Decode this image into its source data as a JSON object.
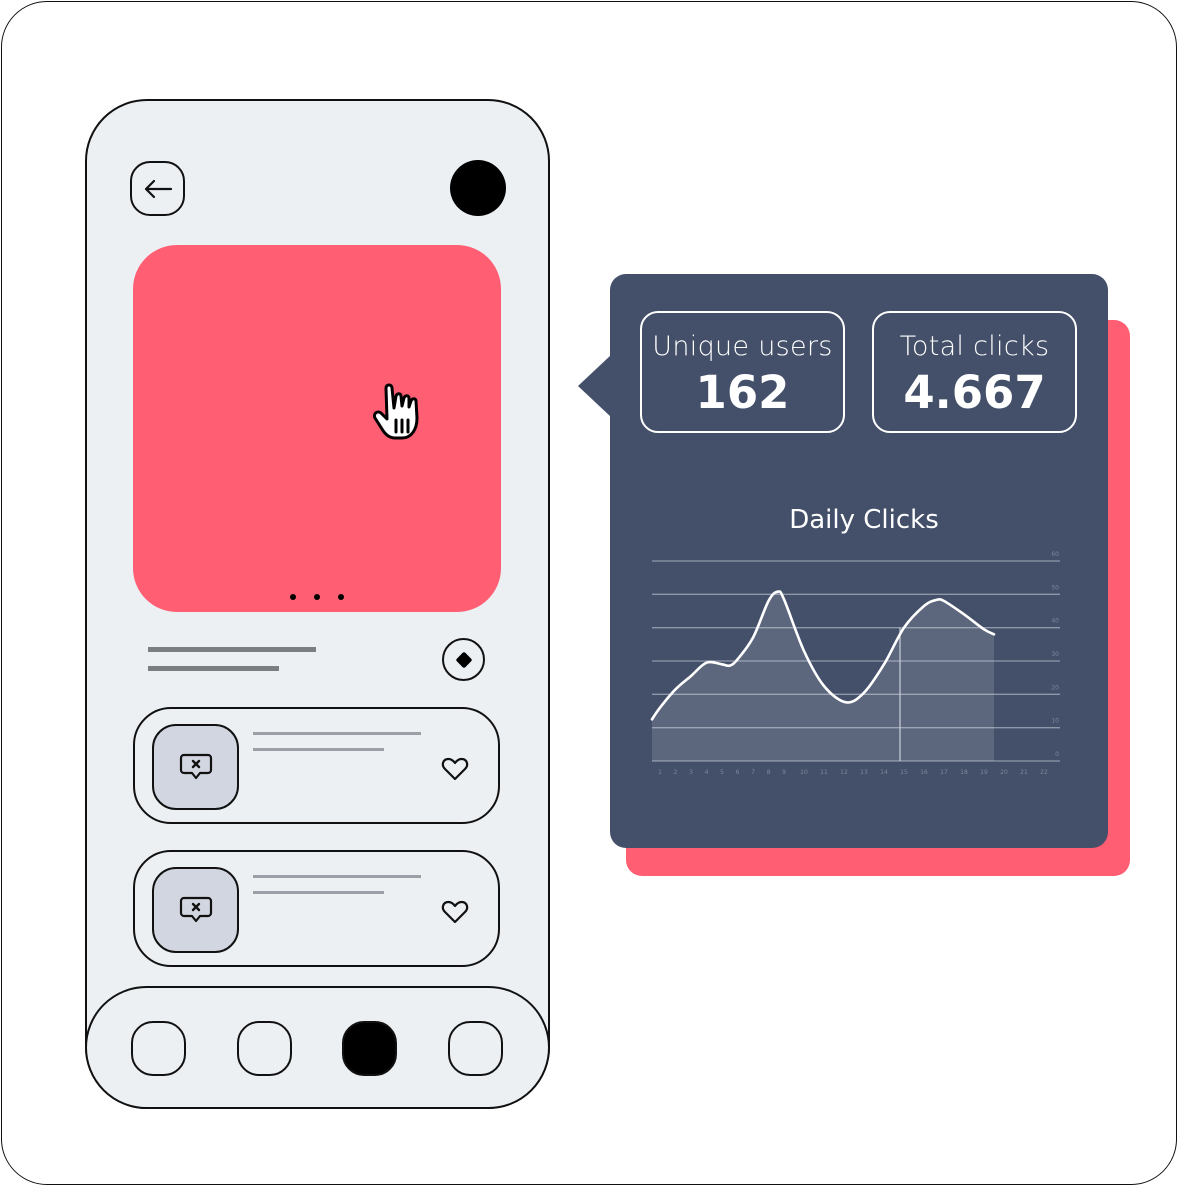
{
  "phone": {
    "back_icon": "arrow-left-icon",
    "avatar_icon": "avatar-circle",
    "hero": {
      "carousel_dots": 3,
      "color": "#ff5e73",
      "cursor_icon": "hand-pointer-icon"
    },
    "action_icon": "diamond-icon",
    "cards": [
      {
        "thumb_icon": "message-x-icon",
        "like_icon": "heart-icon"
      },
      {
        "thumb_icon": "message-x-icon",
        "like_icon": "heart-icon"
      }
    ],
    "tabbar": {
      "tabs": 4,
      "active_index": 2
    }
  },
  "analytics": {
    "accent": "#ff5e73",
    "panel_color": "#445069",
    "stats": [
      {
        "label": "Unique users",
        "value": "162"
      },
      {
        "label": "Total clicks",
        "value": "4.667"
      }
    ]
  },
  "chart_data": {
    "type": "area",
    "title": "Daily Clicks",
    "xlabel": "",
    "ylabel": "",
    "x_labels": [
      "1",
      "2",
      "3",
      "4",
      "5",
      "6",
      "7",
      "8",
      "9",
      "10",
      "11",
      "12",
      "13",
      "14",
      "15",
      "16",
      "17",
      "18",
      "19",
      "20",
      "21",
      "22"
    ],
    "y_ticks": [
      0,
      10,
      20,
      30,
      40,
      50,
      60
    ],
    "ylim": [
      0,
      60
    ],
    "grid": true,
    "series": [
      {
        "name": "Daily Clicks",
        "points": [
          [
            0.5,
            12.5
          ],
          [
            1,
            16
          ],
          [
            2,
            21.5
          ],
          [
            3,
            25.5
          ],
          [
            4,
            29.5
          ],
          [
            5,
            29
          ],
          [
            5.5,
            28.6
          ],
          [
            6,
            30.5
          ],
          [
            7,
            37
          ],
          [
            8,
            48
          ],
          [
            8.6,
            50.8
          ],
          [
            9,
            48.5
          ],
          [
            10,
            33
          ],
          [
            11,
            22.5
          ],
          [
            12.1,
            17.6
          ],
          [
            13,
            20.5
          ],
          [
            14,
            29
          ],
          [
            15,
            40
          ],
          [
            16,
            46.5
          ],
          [
            16.6,
            48.3
          ],
          [
            17,
            48
          ],
          [
            18,
            44
          ],
          [
            19,
            39.5
          ],
          [
            19.5,
            38
          ]
        ]
      }
    ],
    "highlight_x": 14.8
  }
}
